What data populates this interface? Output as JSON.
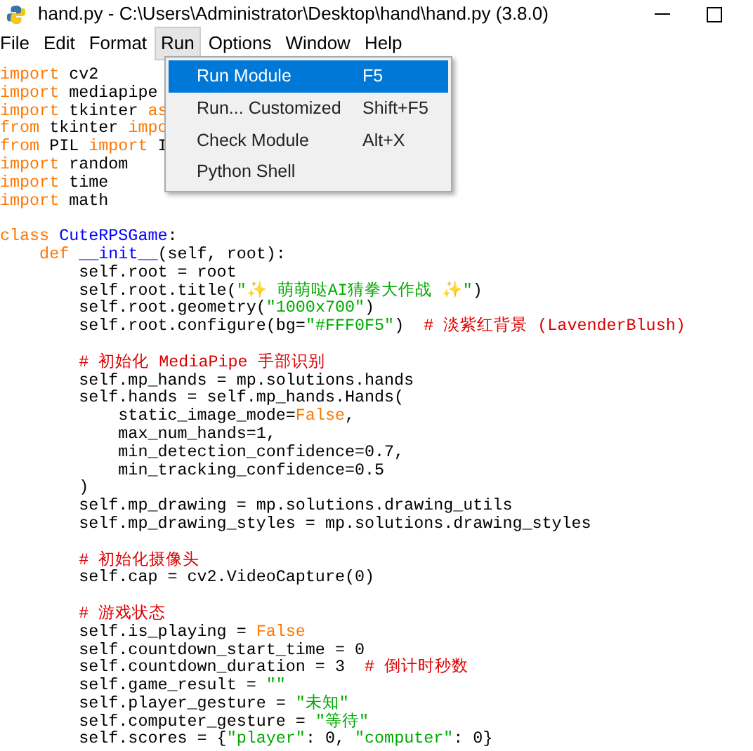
{
  "window": {
    "title": "hand.py - C:\\Users\\Administrator\\Desktop\\hand\\hand.py (3.8.0)"
  },
  "menu_bar": [
    {
      "label": "File",
      "selected": false
    },
    {
      "label": "Edit",
      "selected": false
    },
    {
      "label": "Format",
      "selected": false
    },
    {
      "label": "Run",
      "selected": true
    },
    {
      "label": "Options",
      "selected": false
    },
    {
      "label": "Window",
      "selected": false
    },
    {
      "label": "Help",
      "selected": false
    }
  ],
  "run_menu": [
    {
      "label": "Run Module",
      "shortcut": "F5",
      "selected": true
    },
    {
      "label": "Run... Customized",
      "shortcut": "Shift+F5",
      "selected": false
    },
    {
      "label": "Check Module",
      "shortcut": "Alt+X",
      "selected": false
    },
    {
      "label": "Python Shell",
      "selected": false
    }
  ],
  "editor": {
    "lines": [
      {
        "kind": "code",
        "tokens": [
          {
            "kind": "keyword",
            "text": "import"
          },
          {
            "kind": "plain",
            "text": " cv2"
          }
        ]
      },
      {
        "kind": "code",
        "tokens": [
          {
            "kind": "keyword",
            "text": "import"
          },
          {
            "kind": "plain",
            "text": " mediapipe"
          }
        ]
      },
      {
        "kind": "code",
        "tokens": [
          {
            "kind": "keyword",
            "text": "import"
          },
          {
            "kind": "plain",
            "text": " tkinter "
          },
          {
            "kind": "keyword",
            "text": "as"
          }
        ]
      },
      {
        "kind": "code",
        "tokens": [
          {
            "kind": "keyword",
            "text": "from"
          },
          {
            "kind": "plain",
            "text": " tkinter "
          },
          {
            "kind": "keyword",
            "text": "impo"
          }
        ]
      },
      {
        "kind": "code",
        "tokens": [
          {
            "kind": "keyword",
            "text": "from"
          },
          {
            "kind": "plain",
            "text": " PIL "
          },
          {
            "kind": "keyword",
            "text": "import"
          },
          {
            "kind": "plain",
            "text": " I"
          }
        ]
      },
      {
        "kind": "code",
        "tokens": [
          {
            "kind": "keyword",
            "text": "import"
          },
          {
            "kind": "plain",
            "text": " random"
          }
        ]
      },
      {
        "kind": "code",
        "tokens": [
          {
            "kind": "keyword",
            "text": "import"
          },
          {
            "kind": "plain",
            "text": " time"
          }
        ]
      },
      {
        "kind": "code",
        "tokens": [
          {
            "kind": "keyword",
            "text": "import"
          },
          {
            "kind": "plain",
            "text": " math"
          }
        ]
      },
      {
        "kind": "blank"
      },
      {
        "kind": "code",
        "tokens": [
          {
            "kind": "keyword",
            "text": "class"
          },
          {
            "kind": "definition",
            "text": " CuteRPSGame"
          },
          {
            "kind": "plain",
            "text": ":"
          }
        ]
      },
      {
        "kind": "code",
        "tokens": [
          {
            "kind": "keyword",
            "text": "    def"
          },
          {
            "kind": "definition",
            "text": " __init__"
          },
          {
            "kind": "plain",
            "text": "(self, root):"
          }
        ]
      },
      {
        "kind": "code",
        "tokens": [
          {
            "kind": "plain",
            "text": "        self.root = root"
          }
        ]
      },
      {
        "kind": "code",
        "tokens": [
          {
            "kind": "plain",
            "text": "        self.root.title("
          },
          {
            "kind": "string",
            "text": "\"✨ 萌萌哒AI猜拳大作战 ✨\""
          },
          {
            "kind": "plain",
            "text": ")"
          }
        ]
      },
      {
        "kind": "code",
        "tokens": [
          {
            "kind": "plain",
            "text": "        self.root.geometry("
          },
          {
            "kind": "string",
            "text": "\"1000x700\""
          },
          {
            "kind": "plain",
            "text": ")"
          }
        ]
      },
      {
        "kind": "code",
        "tokens": [
          {
            "kind": "plain",
            "text": "        self.root.configure(bg="
          },
          {
            "kind": "string",
            "text": "\"#FFF0F5\""
          },
          {
            "kind": "plain",
            "text": ")  "
          },
          {
            "kind": "comment",
            "text": "# 淡紫红背景 (LavenderBlush)"
          }
        ]
      },
      {
        "kind": "blank"
      },
      {
        "kind": "code",
        "tokens": [
          {
            "kind": "comment",
            "text": "        # 初始化 MediaPipe 手部识别"
          }
        ]
      },
      {
        "kind": "code",
        "tokens": [
          {
            "kind": "plain",
            "text": "        self.mp_hands = mp.solutions.hands"
          }
        ]
      },
      {
        "kind": "code",
        "tokens": [
          {
            "kind": "plain",
            "text": "        self.hands = self.mp_hands.Hands("
          }
        ]
      },
      {
        "kind": "code",
        "tokens": [
          {
            "kind": "plain",
            "text": "            static_image_mode="
          },
          {
            "kind": "keyword",
            "text": "False"
          },
          {
            "kind": "plain",
            "text": ","
          }
        ]
      },
      {
        "kind": "code",
        "tokens": [
          {
            "kind": "plain",
            "text": "            max_num_hands=1,"
          }
        ]
      },
      {
        "kind": "code",
        "tokens": [
          {
            "kind": "plain",
            "text": "            min_detection_confidence=0.7,"
          }
        ]
      },
      {
        "kind": "code",
        "tokens": [
          {
            "kind": "plain",
            "text": "            min_tracking_confidence=0.5"
          }
        ]
      },
      {
        "kind": "code",
        "tokens": [
          {
            "kind": "plain",
            "text": "        )"
          }
        ]
      },
      {
        "kind": "code",
        "tokens": [
          {
            "kind": "plain",
            "text": "        self.mp_drawing = mp.solutions.drawing_utils"
          }
        ]
      },
      {
        "kind": "code",
        "tokens": [
          {
            "kind": "plain",
            "text": "        self.mp_drawing_styles = mp.solutions.drawing_styles"
          }
        ]
      },
      {
        "kind": "blank"
      },
      {
        "kind": "code",
        "tokens": [
          {
            "kind": "comment",
            "text": "        # 初始化摄像头"
          }
        ]
      },
      {
        "kind": "code",
        "tokens": [
          {
            "kind": "plain",
            "text": "        self.cap = cv2.VideoCapture(0)"
          }
        ]
      },
      {
        "kind": "blank"
      },
      {
        "kind": "code",
        "tokens": [
          {
            "kind": "comment",
            "text": "        # 游戏状态"
          }
        ]
      },
      {
        "kind": "code",
        "tokens": [
          {
            "kind": "plain",
            "text": "        self.is_playing = "
          },
          {
            "kind": "keyword",
            "text": "False"
          }
        ]
      },
      {
        "kind": "code",
        "tokens": [
          {
            "kind": "plain",
            "text": "        self.countdown_start_time = 0"
          }
        ]
      },
      {
        "kind": "code",
        "tokens": [
          {
            "kind": "plain",
            "text": "        self.countdown_duration = 3  "
          },
          {
            "kind": "comment",
            "text": "# 倒计时秒数"
          }
        ]
      },
      {
        "kind": "code",
        "tokens": [
          {
            "kind": "plain",
            "text": "        self.game_result = "
          },
          {
            "kind": "string",
            "text": "\"\""
          }
        ]
      },
      {
        "kind": "code",
        "tokens": [
          {
            "kind": "plain",
            "text": "        self.player_gesture = "
          },
          {
            "kind": "string",
            "text": "\"未知\""
          }
        ]
      },
      {
        "kind": "code",
        "tokens": [
          {
            "kind": "plain",
            "text": "        self.computer_gesture = "
          },
          {
            "kind": "string",
            "text": "\"等待\""
          }
        ]
      },
      {
        "kind": "code",
        "tokens": [
          {
            "kind": "plain",
            "text": "        self.scores = {"
          },
          {
            "kind": "string",
            "text": "\"player\""
          },
          {
            "kind": "plain",
            "text": ": 0, "
          },
          {
            "kind": "string",
            "text": "\"computer\""
          },
          {
            "kind": "plain",
            "text": ": 0}"
          }
        ]
      }
    ]
  }
}
